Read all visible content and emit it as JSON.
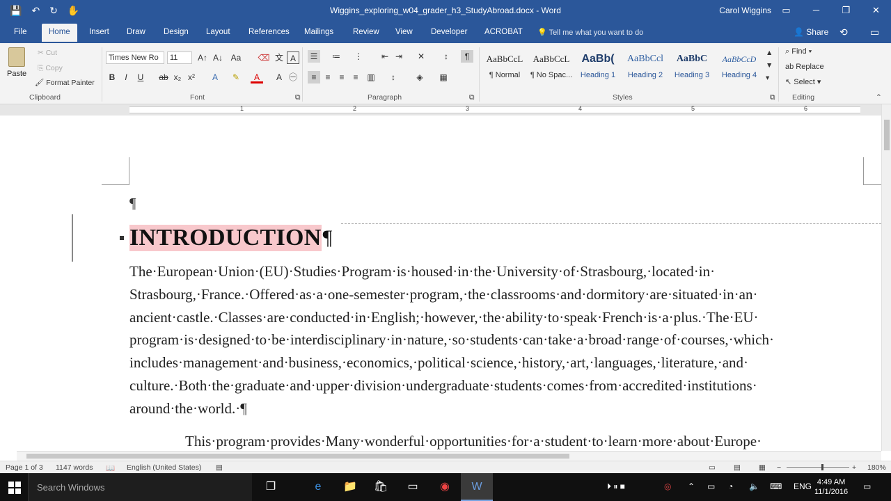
{
  "window": {
    "title": "Wiggins_exploring_w04_grader_h3_StudyAbroad.docx - Word",
    "user": "Carol Wiggins",
    "controls": [
      "▭",
      "─",
      "❐",
      "✕"
    ]
  },
  "qat": [
    "💾",
    "↶",
    "↻",
    "✋"
  ],
  "tabs": [
    "File",
    "Home",
    "Insert",
    "Draw",
    "Design",
    "Layout",
    "References",
    "Mailings",
    "Review",
    "View",
    "Developer",
    "ACROBAT"
  ],
  "tell_me": "Tell me what you want to do",
  "share": "Share",
  "clipboard": {
    "paste": "Paste",
    "cut": "Cut",
    "copy": "Copy",
    "format_painter": "Format Painter",
    "label": "Clipboard"
  },
  "font": {
    "name": "Times New Ro",
    "size": "11",
    "label": "Font"
  },
  "paragraph": {
    "label": "Paragraph"
  },
  "styles": {
    "label": "Styles",
    "items": [
      {
        "sample": "AaBbCcL",
        "name": "¶ Normal"
      },
      {
        "sample": "AaBbCcL",
        "name": "¶ No Spac..."
      },
      {
        "sample": "AaBb(",
        "name": "Heading 1"
      },
      {
        "sample": "AaBbCcl",
        "name": "Heading 2"
      },
      {
        "sample": "AaBbC",
        "name": "Heading 3"
      },
      {
        "sample": "AaBbCcD",
        "name": "Heading 4"
      }
    ]
  },
  "editing": {
    "find": "Find",
    "replace": "Replace",
    "select": "Select",
    "label": "Editing"
  },
  "ruler": {
    "numbers": [
      "1",
      "2",
      "3",
      "4",
      "5",
      "6"
    ]
  },
  "document": {
    "empty_para": "¶",
    "heading": "INTRODUCTION",
    "heading_mark": "¶",
    "para1": "The·European·Union·(EU)·Studies·Program·is·housed·in·the·University·of·Strasbourg,·located·in· Strasbourg,·France.·Offered·as·a·one-semester·program,·the·classrooms·and·dormitory·are·situated·in·an· ancient·castle.·Classes·are·conducted·in·English;·however,·the·ability·to·speak·French·is·a·plus.·The·EU· program·is·designed·to·be·interdisciplinary·in·nature,·so·students·can·take·a·broad·range·of·courses,·which· includes·management·and·business,·economics,·political·science,·history,·art,·languages,·literature,·and· culture.·Both·the·graduate·and·upper·division·undergraduate·students·comes·from·accredited·institutions· around·the·world.·¶",
    "para2": "This·program·provides·Many·wonderful·opportunities·for·a·student·to·learn·more·about·Europe·"
  },
  "status": {
    "page": "Page 1 of 3",
    "words": "1147 words",
    "language": "English (United States)",
    "zoom": "180%"
  },
  "taskbar": {
    "search": "Search Windows",
    "time": "4:49 AM",
    "date": "11/1/2016",
    "lang": "ENG"
  }
}
